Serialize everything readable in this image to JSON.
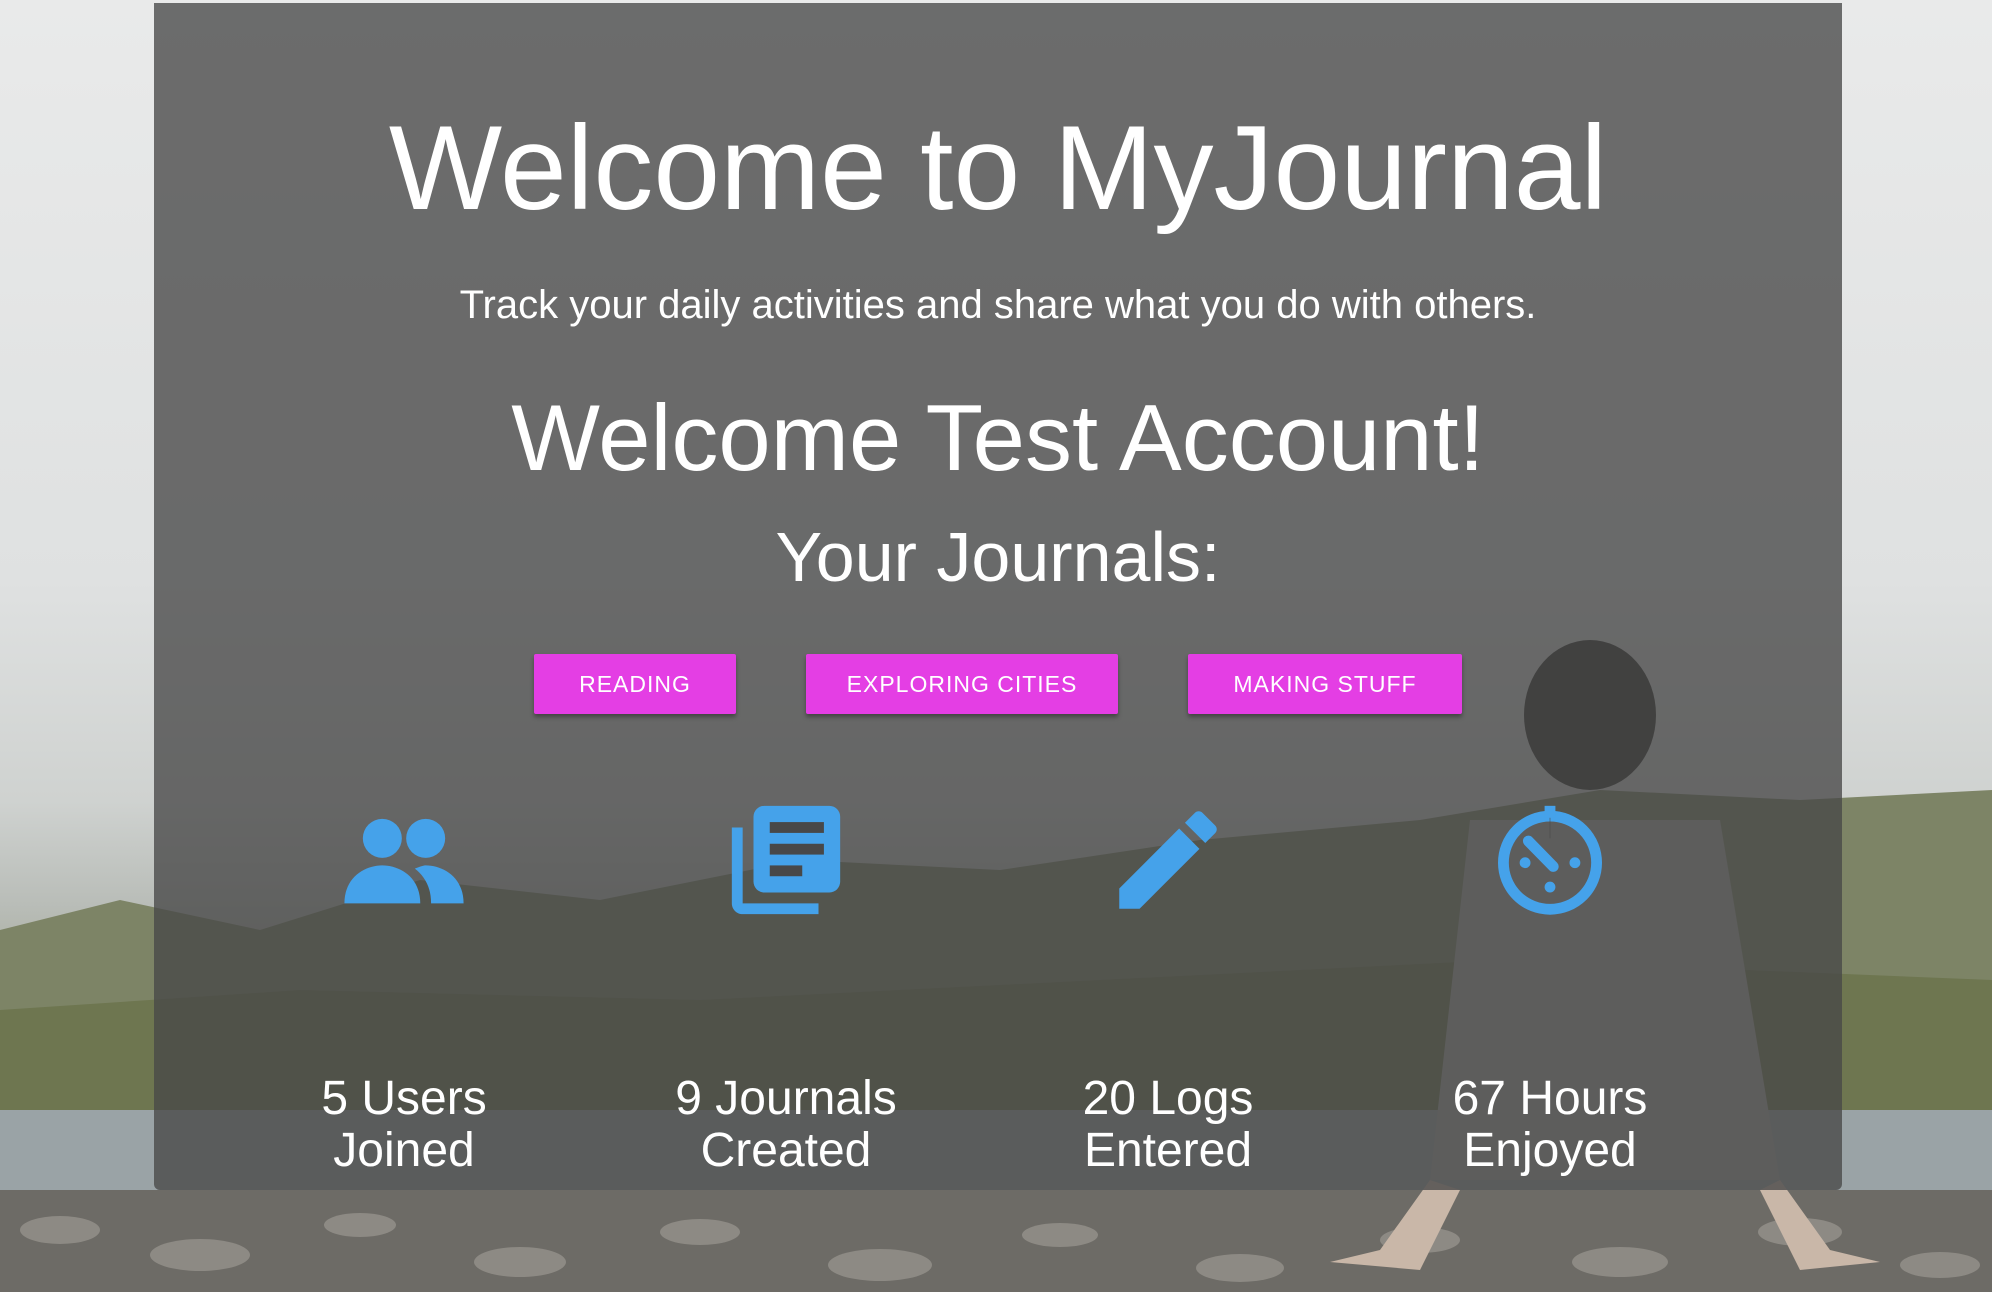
{
  "header": {
    "title": "Welcome to MyJournal",
    "subtitle": "Track your daily activities and share what you do with others."
  },
  "user": {
    "greeting": "Welcome Test Account!"
  },
  "journals": {
    "heading": "Your Journals:",
    "buttons": [
      "READING",
      "EXPLORING CITIES",
      "MAKING STUFF"
    ]
  },
  "stats": [
    {
      "icon": "people-icon",
      "label": "5 Users Joined"
    },
    {
      "icon": "journal-icon",
      "label": "9 Journals Created"
    },
    {
      "icon": "pencil-icon",
      "label": "20 Logs Entered"
    },
    {
      "icon": "timer-icon",
      "label": "67 Hours Enjoyed"
    }
  ],
  "colors": {
    "accent": "#e43ee4",
    "icon": "#45a2ea",
    "overlay": "#484848",
    "text": "#ffffff"
  }
}
